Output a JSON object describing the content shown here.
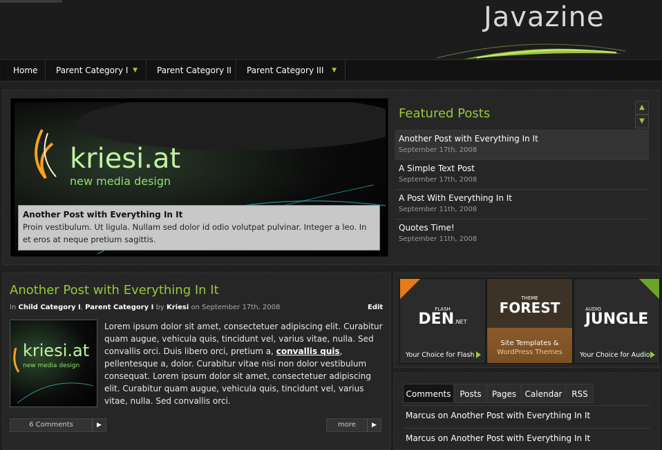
{
  "site": {
    "logo_text": "Javazine"
  },
  "nav": {
    "items": [
      {
        "label": "Home",
        "has_dropdown": false
      },
      {
        "label": "Parent Category I",
        "has_dropdown": true
      },
      {
        "label": "Parent Category II",
        "has_dropdown": false
      },
      {
        "label": "Parent Category III",
        "has_dropdown": true
      }
    ]
  },
  "slider": {
    "image_brand": "kriesi.at",
    "image_tagline": "new media design",
    "caption_title": "Another Post with Everything In It",
    "caption_text": "Proin vestibulum. Ut ligula. Nullam sed dolor id odio volutpat pulvinar. Integer a leo. In et eros at neque pretium sagittis."
  },
  "featured": {
    "title": "Featured Posts",
    "posts": [
      {
        "title": "Another Post with Everything In It",
        "date": "September 17th, 2008"
      },
      {
        "title": "A Simple Text Post",
        "date": "September 17th, 2008"
      },
      {
        "title": "A Post With Everything In It",
        "date": "September 11th, 2008"
      },
      {
        "title": "Quotes Time!",
        "date": "September 11th, 2008"
      }
    ]
  },
  "post": {
    "title": "Another Post with Everything In It",
    "meta_in": "In",
    "category1": "Child Category I",
    "category2": "Parent Category I",
    "meta_by": "by",
    "author": "Kriesi",
    "meta_on": "on September 17th, 2008",
    "edit_label": "Edit",
    "body_part1": "Lorem ipsum dolor sit amet, consectetuer adipiscing elit. Curabitur quam augue, vehicula quis, tincidunt vel, varius vitae, nulla. Sed convallis orci. Duis libero orci, pretium a,",
    "body_link": "convallis quis",
    "body_part2": ", pellentesque a, dolor. Curabitur vitae nisi non dolor vestibulum consequat. Lorem ipsum dolor sit amet, consectetuer adipiscing elit. Curabitur quam augue, vehicula quis, tincidunt vel, varius vitae, nulla. Sed convallis orci.",
    "comments_label": "6 Comments",
    "more_label": "more"
  },
  "ads": [
    {
      "small": "FLASH",
      "brand": "DEN",
      "suffix": ".NET",
      "choice": "Your Choice for Flash"
    },
    {
      "small": "THEME",
      "brand": "FOREST",
      "line1": "Site Templates &",
      "line2": "WordPress Themes"
    },
    {
      "small": "AUDIO",
      "brand": "JUNGLE",
      "choice": "Your Choice for Audio"
    }
  ],
  "sidebar_tabs": {
    "tabs": [
      "Comments",
      "Posts",
      "Pages",
      "Calendar",
      "RSS"
    ],
    "comments": [
      "Marcus on Another Post with Everything In It",
      "Marcus on Another Post with Everything In It"
    ]
  },
  "colors": {
    "accent": "#9ac838",
    "background": "#1f1f1f"
  }
}
